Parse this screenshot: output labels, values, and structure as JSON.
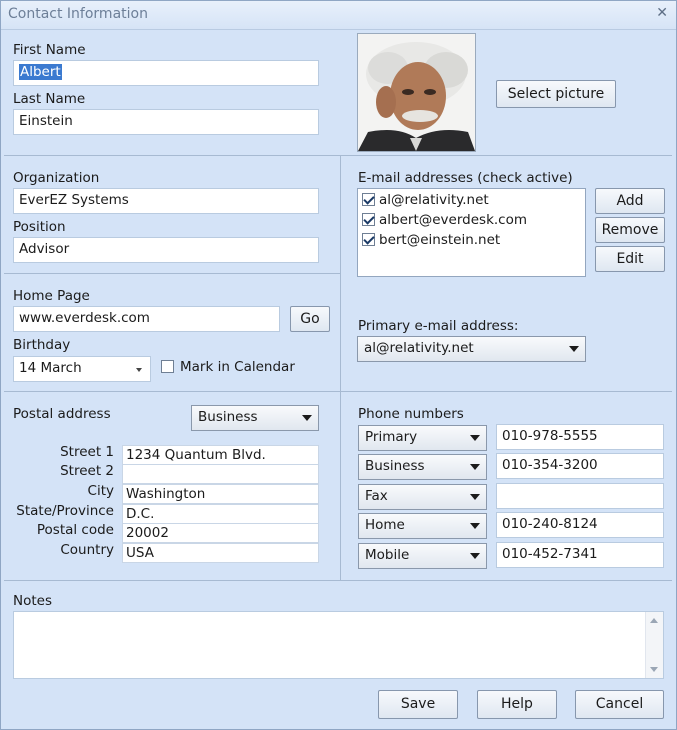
{
  "window": {
    "title": "Contact Information"
  },
  "name": {
    "first_label": "First Name",
    "first_value": "Albert",
    "last_label": "Last Name",
    "last_value": "Einstein"
  },
  "picture": {
    "select_label": "Select picture"
  },
  "org": {
    "org_label": "Organization",
    "org_value": "EverEZ Systems",
    "pos_label": "Position",
    "pos_value": "Advisor"
  },
  "web": {
    "home_label": "Home Page",
    "home_value": "www.everdesk.com",
    "go_label": "Go",
    "birthday_label": "Birthday",
    "birthday_value": "14 March",
    "calendar_label": "Mark in Calendar"
  },
  "email": {
    "header": "E-mail addresses (check active)",
    "items": [
      {
        "address": "al@relativity.net",
        "checked": true
      },
      {
        "address": "albert@everdesk.com",
        "checked": true
      },
      {
        "address": "bert@einstein.net",
        "checked": true
      }
    ],
    "add_label": "Add",
    "remove_label": "Remove",
    "edit_label": "Edit",
    "primary_label": "Primary e-mail address:",
    "primary_value": "al@relativity.net"
  },
  "postal": {
    "label": "Postal address",
    "type_value": "Business",
    "street1_label": "Street 1",
    "street1_value": "1234 Quantum Blvd.",
    "street2_label": "Street 2",
    "street2_value": "",
    "city_label": "City",
    "city_value": "Washington",
    "state_label": "State/Province",
    "state_value": "D.C.",
    "postal_label": "Postal code",
    "postal_value": "20002",
    "country_label": "Country",
    "country_value": "USA"
  },
  "phones": {
    "label": "Phone numbers",
    "rows": [
      {
        "type": "Primary",
        "number": "010-978-5555"
      },
      {
        "type": "Business",
        "number": "010-354-3200"
      },
      {
        "type": "Fax",
        "number": ""
      },
      {
        "type": "Home",
        "number": "010-240-8124"
      },
      {
        "type": "Mobile",
        "number": "010-452-7341"
      }
    ]
  },
  "notes": {
    "label": "Notes",
    "value": ""
  },
  "footer": {
    "save_label": "Save",
    "help_label": "Help",
    "cancel_label": "Cancel"
  }
}
